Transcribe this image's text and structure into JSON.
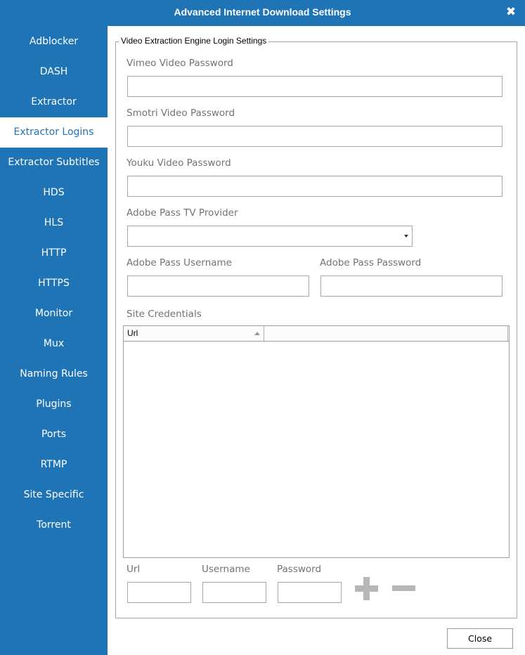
{
  "window": {
    "title": "Advanced Internet Download Settings",
    "close_glyph": "✖",
    "close_icon": "close-icon"
  },
  "sidebar": {
    "items": [
      {
        "label": "Adblocker",
        "active": false
      },
      {
        "label": "DASH",
        "active": false
      },
      {
        "label": "Extractor",
        "active": false
      },
      {
        "label": "Extractor Logins",
        "active": true
      },
      {
        "label": "Extractor Subtitles",
        "active": false
      },
      {
        "label": "HDS",
        "active": false
      },
      {
        "label": "HLS",
        "active": false
      },
      {
        "label": "HTTP",
        "active": false
      },
      {
        "label": "HTTPS",
        "active": false
      },
      {
        "label": "Monitor",
        "active": false
      },
      {
        "label": "Mux",
        "active": false
      },
      {
        "label": "Naming Rules",
        "active": false
      },
      {
        "label": "Plugins",
        "active": false
      },
      {
        "label": "Ports",
        "active": false
      },
      {
        "label": "RTMP",
        "active": false
      },
      {
        "label": "Site Specific",
        "active": false
      },
      {
        "label": "Torrent",
        "active": false
      }
    ]
  },
  "group": {
    "title": "Video Extraction Engine Login Settings"
  },
  "fields": {
    "vimeo_label": "Vimeo Video Password",
    "vimeo_value": "",
    "smotri_label": "Smotri Video Password",
    "smotri_value": "",
    "youku_label": "Youku Video Password",
    "youku_value": "",
    "tv_provider_label": "Adobe Pass TV Provider",
    "tv_provider_value": "",
    "adobe_username_label": "Adobe Pass Username",
    "adobe_username_value": "",
    "adobe_password_label": "Adobe Pass Password",
    "adobe_password_value": ""
  },
  "credentials": {
    "label": "Site Credentials",
    "columns": [
      "Url",
      ""
    ],
    "rows": [],
    "sort_icon": "sort-ascending-icon",
    "url_label": "Url",
    "url_value": "",
    "username_label": "Username",
    "username_value": "",
    "password_label": "Password",
    "password_value": "",
    "add_icon": "plus-icon",
    "remove_icon": "minus-icon"
  },
  "buttons": {
    "close_label": "Close"
  },
  "colors": {
    "accent": "#1f74b6",
    "label_gray": "#727272",
    "border_gray": "#a6a6a6",
    "icon_gray": "#b7b7b7"
  }
}
